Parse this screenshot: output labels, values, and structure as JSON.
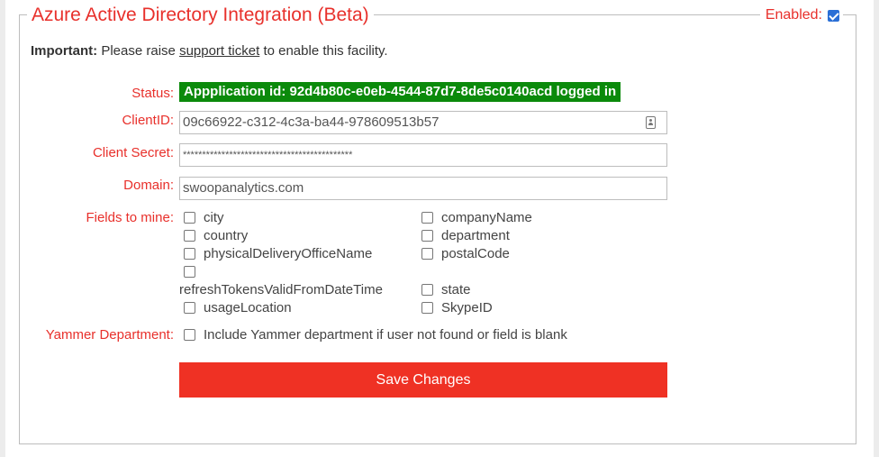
{
  "section": {
    "title": "Azure Active Directory Integration (Beta)",
    "enabled_label": "Enabled:",
    "enabled_checked": true
  },
  "notice": {
    "bold": "Important:",
    "before_link": " Please raise ",
    "link": "support ticket",
    "after_link": " to enable this facility."
  },
  "form": {
    "status_label": "Status:",
    "status_value": "Appplication id: 92d4b80c-e0eb-4544-87d7-8de5c0140acd logged in",
    "clientid_label": "ClientID:",
    "clientid_value": "09c66922-c312-4c3a-ba44-978609513b57",
    "secret_label": "Client Secret:",
    "secret_value": "********************************************",
    "domain_label": "Domain:",
    "domain_value": "swoopanalytics.com",
    "fields_label": "Fields to mine:",
    "fields": [
      {
        "label": "city",
        "checked": false
      },
      {
        "label": "companyName",
        "checked": false
      },
      {
        "label": "country",
        "checked": false
      },
      {
        "label": "department",
        "checked": false
      },
      {
        "label": "physicalDeliveryOfficeName",
        "checked": false
      },
      {
        "label": "postalCode",
        "checked": false
      },
      {
        "label": "refreshTokensValidFromDateTime",
        "checked": false
      },
      {
        "label": "state",
        "checked": false
      },
      {
        "label": "usageLocation",
        "checked": false
      },
      {
        "label": "SkypeID",
        "checked": false
      }
    ],
    "yammer_label": "Yammer Department:",
    "yammer_option": "Include Yammer department if user not found or field is blank",
    "yammer_checked": false,
    "save_label": "Save Changes"
  },
  "icons": {
    "enabled_checkbox": "checkbox-checked-icon",
    "clientid_field": "contact-card-icon"
  },
  "colors": {
    "accent": "#e8302b",
    "status_bg": "#0b8a0b",
    "button_bg": "#ef3124",
    "checkbox_checked": "#2b6fd6"
  }
}
